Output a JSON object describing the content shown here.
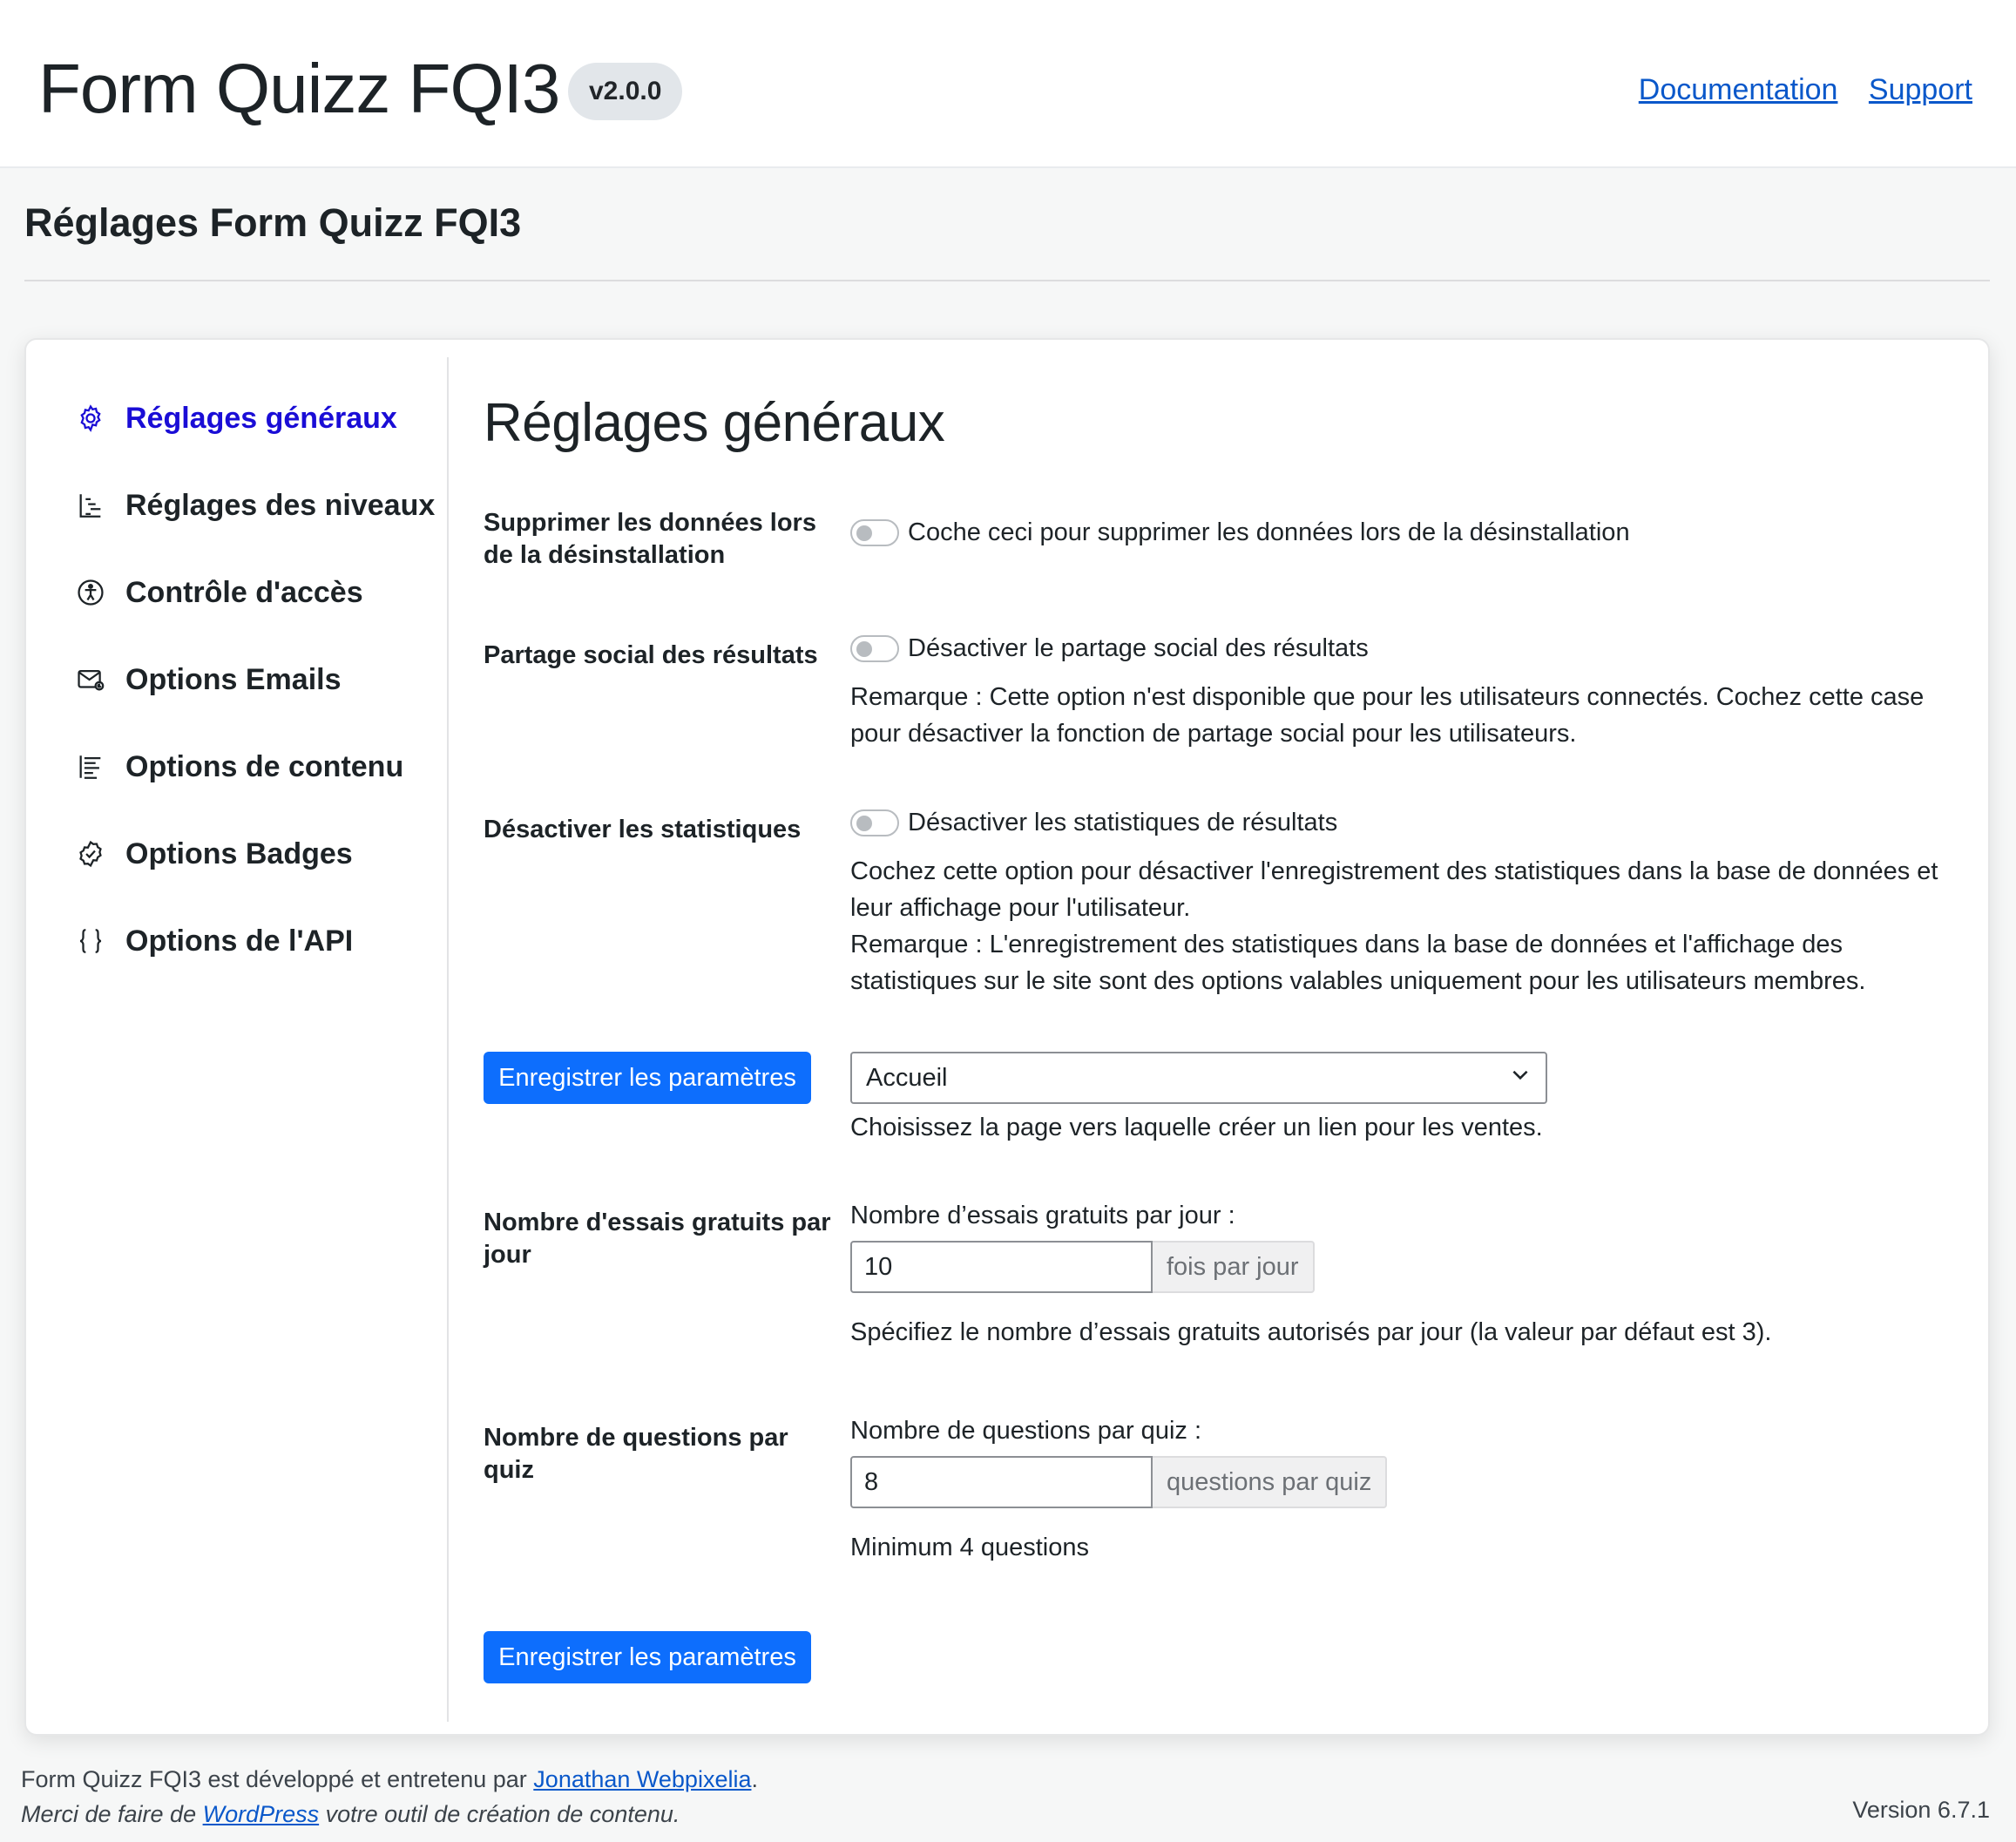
{
  "header": {
    "title": "Form Quizz FQI3",
    "version": "v2.0.0",
    "links": {
      "documentation": "Documentation",
      "support": "Support"
    }
  },
  "page": {
    "title": "Réglages Form Quizz FQI3"
  },
  "sidebar": {
    "items": [
      {
        "label": "Réglages généraux",
        "icon": "gear-icon",
        "active": true
      },
      {
        "label": "Réglages des niveaux",
        "icon": "levels-icon",
        "active": false
      },
      {
        "label": "Contrôle d'accès",
        "icon": "accessibility-icon",
        "active": false
      },
      {
        "label": "Options Emails",
        "icon": "email-icon",
        "active": false
      },
      {
        "label": "Options de contenu",
        "icon": "content-icon",
        "active": false
      },
      {
        "label": "Options Badges",
        "icon": "badge-icon",
        "active": false
      },
      {
        "label": "Options de l'API",
        "icon": "braces-icon",
        "active": false
      }
    ]
  },
  "main": {
    "heading": "Réglages généraux",
    "rows": {
      "delete_data": {
        "label": "Supprimer les données lors de la désinstallation",
        "toggle_text": "Coche ceci pour supprimer les données lors de la désinstallation"
      },
      "social_share": {
        "label": "Partage social des résultats",
        "toggle_text": "Désactiver le partage social des résultats",
        "help": "Remarque : Cette option n'est disponible que pour les utilisateurs connectés. Cochez cette case pour désactiver la fonction de partage social pour les utilisateurs."
      },
      "stats": {
        "label": "Désactiver les statistiques",
        "toggle_text": "Désactiver les statistiques de résultats",
        "help1": "Cochez cette option pour désactiver l'enregistrement des statistiques dans la base de données et leur affichage pour l'utilisateur.",
        "help2": "Remarque : L'enregistrement des statistiques dans la base de données et l'affichage des statistiques sur le site sont des options valables uniquement pour les utilisateurs membres."
      },
      "sales_page": {
        "button": "Enregistrer les paramètres",
        "select_value": "Accueil",
        "help": "Choisissez la page vers laquelle créer un lien pour les ventes."
      },
      "free_trials": {
        "label": "Nombre d'essais gratuits par jour",
        "field_label": "Nombre d’essais gratuits par jour :",
        "value": "10",
        "suffix": "fois par jour",
        "help": "Spécifiez le nombre d’essais gratuits autorisés par jour (la valeur par défaut est 3)."
      },
      "questions": {
        "label": "Nombre de questions par quiz",
        "field_label": "Nombre de questions par quiz :",
        "value": "8",
        "suffix": "questions par quiz",
        "help": "Minimum 4 questions"
      }
    },
    "save_button": "Enregistrer les paramètres"
  },
  "footer": {
    "line1_prefix": "Form Quizz FQI3 est développé et entretenu par ",
    "line1_link": "Jonathan Webpixelia",
    "line1_suffix": ".",
    "line2_prefix": "Merci de faire de ",
    "line2_link": "WordPress",
    "line2_suffix": " votre outil de création de contenu.",
    "version": "Version 6.7.1"
  },
  "colors": {
    "accent": "#0d6efd",
    "active_nav": "#1a0dd6",
    "link": "#0a58ca"
  }
}
